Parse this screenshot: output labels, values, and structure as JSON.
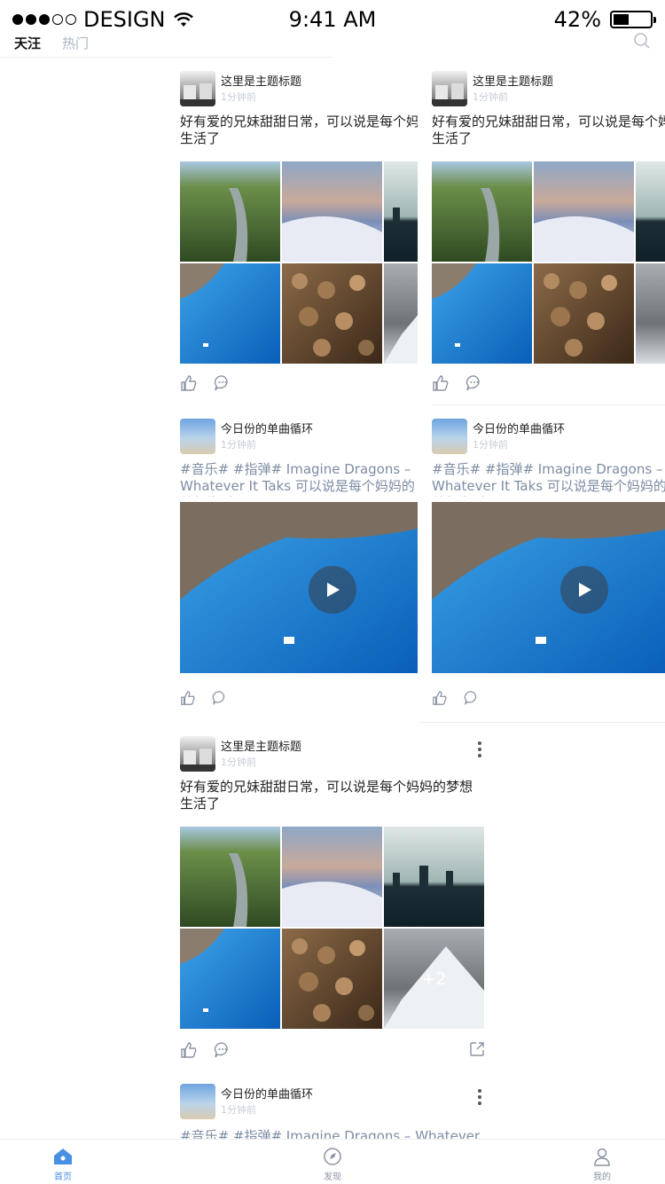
{
  "status_bar": {
    "carrier": "DESIGN",
    "time": "9:41 AM",
    "battery": "42%",
    "battery_level": 0.42
  },
  "tabs": [
    {
      "label": "天汪",
      "active": true
    },
    {
      "label": "热门",
      "active": false
    }
  ],
  "feed": {
    "post_a": {
      "username": "这里是主题标题",
      "time": "1分钟前",
      "text": "好有爱的兄妹甜甜日常，可以说是每个妈妈的梦想生活了",
      "more_count": "+2"
    },
    "post_b": {
      "username": "今日份的单曲循环",
      "time": "1分钟前",
      "text": "#音乐# #指弹# Imagine Dragons – Whatever It Taks 可以说是每个妈妈的梦想生活了"
    }
  },
  "tabbar": [
    {
      "label": "首页",
      "icon": "home-icon",
      "active": true
    },
    {
      "label": "发现",
      "icon": "discover-icon",
      "active": false
    },
    {
      "label": "我的",
      "icon": "profile-icon",
      "active": false
    }
  ],
  "colors": {
    "accent": "#4a90e2",
    "tag_text": "#7d8ca3",
    "meta_text": "#c6ccd6"
  }
}
